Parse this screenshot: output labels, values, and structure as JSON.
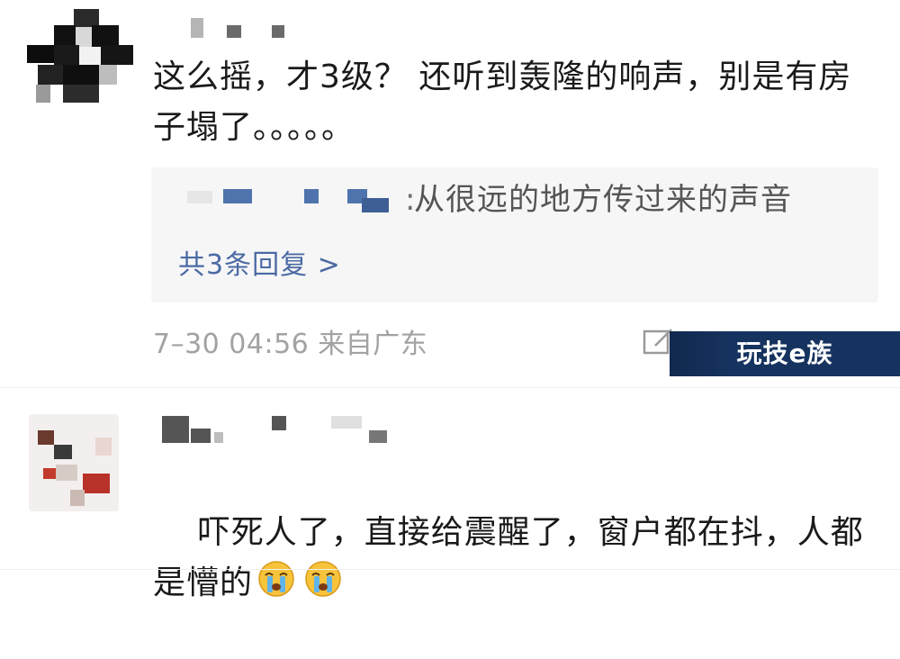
{
  "comments": [
    {
      "text": "这么摇，才3级？ 还听到轰隆的响声，别是有房子塌了。。。。。",
      "reply": {
        "text": "从很远的地方传过来的声音",
        "count_label": "共3条回复 >"
      },
      "meta": "7–30 04:56 来自广东"
    },
    {
      "text": "吓死人了，直接给震醒了，窗户都在抖，人都是懵的",
      "emojis": [
        "crying-face-icon",
        "crying-face-icon"
      ]
    }
  ],
  "watermark": "玩技e族",
  "colors": {
    "reply_background": "#f6f6f7",
    "link_blue": "#4b6aa3",
    "meta_gray": "#a2a2a2",
    "watermark_bg": "#16335f"
  }
}
